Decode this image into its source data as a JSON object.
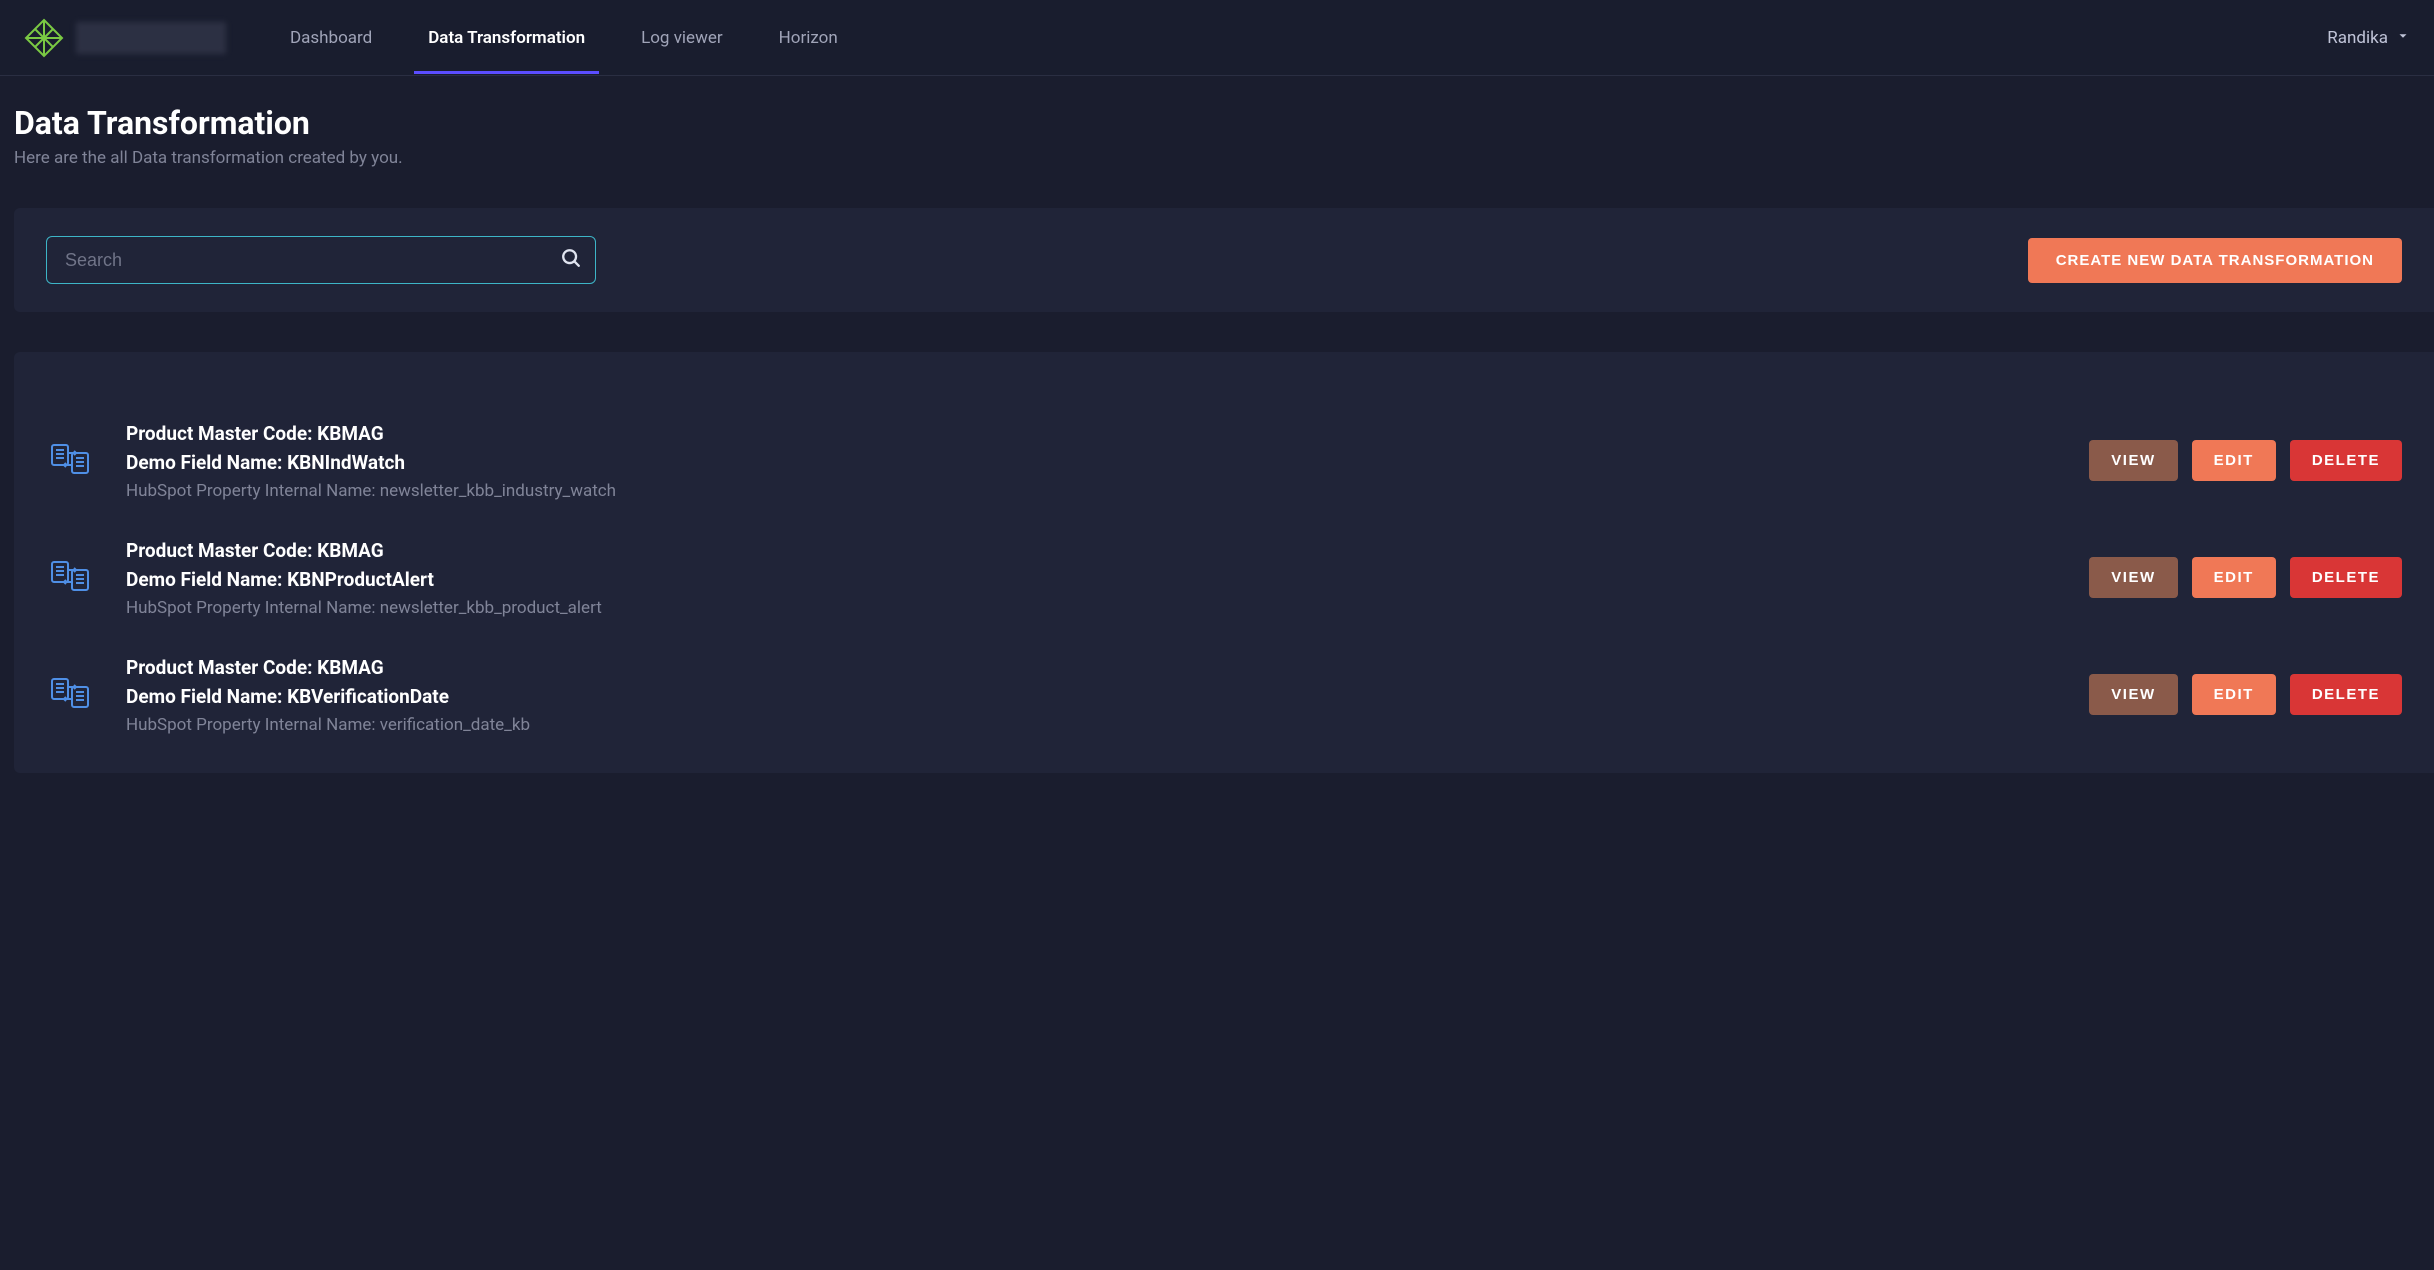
{
  "nav": {
    "links": [
      {
        "label": "Dashboard",
        "active": false
      },
      {
        "label": "Data Transformation",
        "active": true
      },
      {
        "label": "Log viewer",
        "active": false
      },
      {
        "label": "Horizon",
        "active": false
      }
    ],
    "user": "Randika"
  },
  "header": {
    "title": "Data Transformation",
    "subtitle": "Here are the all Data transformation created by you."
  },
  "search": {
    "placeholder": "Search"
  },
  "actions": {
    "create_label": "CREATE NEW DATA TRANSFORMATION",
    "view_label": "VIEW",
    "edit_label": "EDIT",
    "delete_label": "DELETE"
  },
  "labels": {
    "product_master_code": "Product Master Code:",
    "demo_field_name": "Demo Field Name:",
    "hubspot_internal": "HubSpot Property Internal Name:"
  },
  "items": [
    {
      "product_master_code": "KBMAG",
      "demo_field_name": "KBNIndWatch",
      "hubspot_internal": "newsletter_kbb_industry_watch"
    },
    {
      "product_master_code": "KBMAG",
      "demo_field_name": "KBNProductAlert",
      "hubspot_internal": "newsletter_kbb_product_alert"
    },
    {
      "product_master_code": "KBMAG",
      "demo_field_name": "KBVerificationDate",
      "hubspot_internal": "verification_date_kb"
    }
  ]
}
